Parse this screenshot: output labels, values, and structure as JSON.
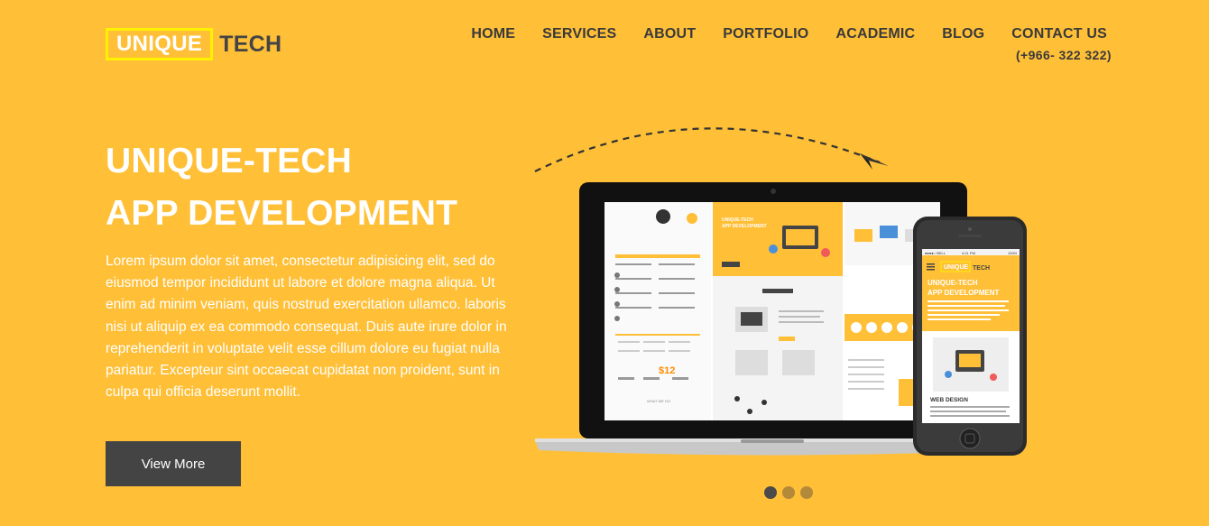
{
  "brand": {
    "boxed": "UNIQUE",
    "rest": "TECH"
  },
  "nav": {
    "items": [
      "HOME",
      "SERVICES",
      "ABOUT",
      "PORTFOLIO",
      "ACADEMIC",
      "BLOG",
      "CONTACT US"
    ],
    "phone": "(+966- 322 322)"
  },
  "hero": {
    "title_line1": "UNIQUE-TECH",
    "title_line2": "APP DEVELOPMENT",
    "body": "Lorem ipsum dolor sit amet, consectetur adipisicing elit, sed do eiusmod tempor incididunt ut labore et dolore magna aliqua. Ut enim ad minim veniam, quis nostrud exercitation ullamco. laboris nisi ut aliquip ex ea commodo consequat. Duis aute irure dolor in reprehenderit in voluptate velit esse cillum dolore eu fugiat nulla pariatur. Excepteur sint occaecat cupidatat non proident, sunt in culpa qui officia deserunt mollit.",
    "button": "View More"
  },
  "mockup": {
    "phone_brand_boxed": "UNIQUE",
    "phone_brand_rest": "TECH",
    "phone_title1": "UNIQUE-TECH",
    "phone_title2": "APP DEVELOPMENT",
    "phone_section": "WEB DESIGN",
    "phone_status_carrier": "●●●●○ BELL",
    "phone_status_time": "4:21 PM",
    "phone_status_battery": "100%",
    "laptop_title1": "UNIQUE-TECH",
    "laptop_title2": "APP DEVELOPMENT",
    "laptop_price": "$12",
    "laptop_section": "WHAT WE DO"
  },
  "slider": {
    "count": 3,
    "active_index": 0
  },
  "colors": {
    "background": "#FFBF37",
    "dark": "#444444",
    "logo_border": "#FFF200"
  },
  "icons": [
    "paper-plane-icon"
  ]
}
